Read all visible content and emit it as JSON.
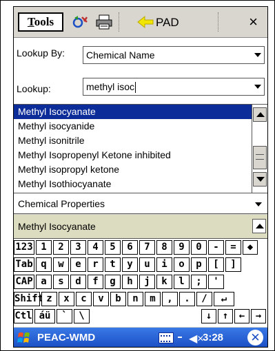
{
  "toolbar": {
    "tools_prefix": "T",
    "tools_rest": "ools",
    "pad_label": "PAD",
    "close_label": "×",
    "icons": [
      "sync-icon",
      "printer-icon",
      "pad-arrow-icon"
    ]
  },
  "form": {
    "lookup_by_label": "Lookup By:",
    "lookup_by_value": "Chemical Name",
    "lookup_label": "Lookup:",
    "lookup_value": "methyl isoc"
  },
  "results": [
    "Methyl Isocyanate",
    "Methyl isocyanide",
    "Methyl isonitrile",
    "Methyl Isopropenyl Ketone inhibited",
    "Methyl isopropyl ketone",
    "Methyl Isothiocyanate"
  ],
  "selected_index": 0,
  "property_selector": "Chemical Properties",
  "detail_text": "Methyl Isocyanate",
  "keyboard": {
    "rows": [
      [
        "123",
        "1",
        "2",
        "3",
        "4",
        "5",
        "6",
        "7",
        "8",
        "9",
        "0",
        "-",
        "=",
        "◆"
      ],
      [
        "Tab",
        "q",
        "w",
        "e",
        "r",
        "t",
        "y",
        "u",
        "i",
        "o",
        "p",
        "[",
        "]"
      ],
      [
        "CAP",
        "a",
        "s",
        "d",
        "f",
        "g",
        "h",
        "j",
        "k",
        "l",
        ";",
        "'"
      ],
      [
        "Shift",
        "z",
        "x",
        "c",
        "v",
        "b",
        "n",
        "m",
        ",",
        ".",
        "/",
        "↵"
      ],
      [
        "Ctl",
        "áü",
        "`",
        "\\",
        "↓",
        "↑",
        "←",
        "→"
      ]
    ]
  },
  "taskbar": {
    "title": "PEAC-WMD",
    "volume": "◀×",
    "time": "3:28",
    "ok_label": "✕"
  },
  "colors": {
    "selection": "#0b2c99",
    "taskbar": "#1b4fc4",
    "chrome": "#d8d6cf",
    "detail_bg": "#dcdcc0"
  }
}
